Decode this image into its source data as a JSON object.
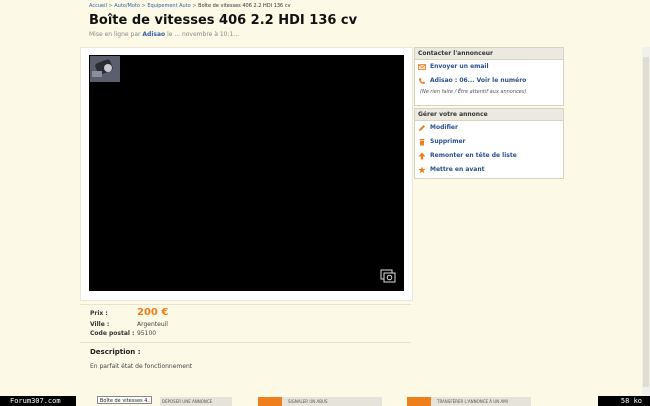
{
  "breadcrumb": {
    "items": [
      "Accueil",
      "Auto/Moto",
      "Equipement Auto",
      "Boîte de vitesses 406 2.2 HDI 136 cv"
    ],
    "separator": ">"
  },
  "ad": {
    "title": "Boîte de vitesses 406 2.2 HDI 136 cv",
    "posted_prefix": "Mise en ligne par",
    "posted_user": "Adisao",
    "posted_suffix": "le ... novembre à 10:1..."
  },
  "contact": {
    "header": "Contacter l'annonceur",
    "email_label": "Envoyer un email",
    "phone_label": "Adisao : 06... Voir le numéro",
    "note": "(Ne rien faire / Être attentif aux annonces)"
  },
  "manage": {
    "header": "Gérer votre annonce",
    "actions": [
      {
        "label": "Modifier",
        "icon": "pencil-icon"
      },
      {
        "label": "Supprimer",
        "icon": "trash-icon"
      },
      {
        "label": "Remonter en tête de liste",
        "icon": "arrow-up-icon"
      },
      {
        "label": "Mettre en avant",
        "icon": "star-icon"
      }
    ]
  },
  "details": {
    "price_label": "Prix :",
    "price_value": "200 €",
    "city_label": "Ville :",
    "city_value": "Argenteuil",
    "postal_label": "Code postal :",
    "postal_value": "95100"
  },
  "description": {
    "title": "Description :",
    "text": "En parfait état de fonctionnement"
  },
  "taskbar": {
    "left_text": "Forum307.com",
    "right_text": "58 ko",
    "mid_text": "Boîte de vitesses 4...",
    "buttons": [
      "DÉPOSER UNE ANNONCE",
      "SIGNALER UN ABUS",
      "TRANSFÉRER L'ANNONCE À UN AMI"
    ]
  },
  "colors": {
    "accent": "#ef7e1c",
    "link": "#28508f",
    "background": "#fcf9e6"
  }
}
